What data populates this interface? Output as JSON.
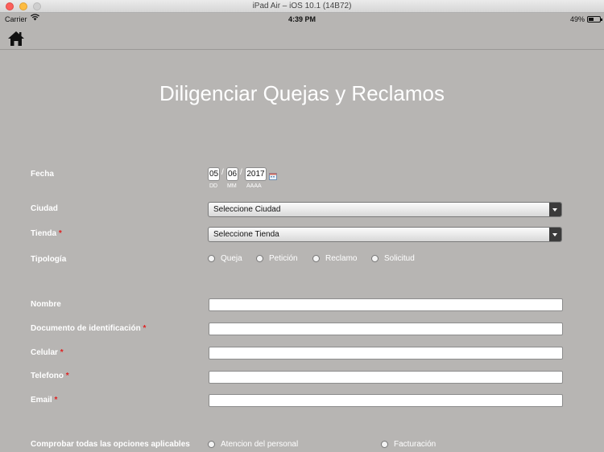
{
  "window": {
    "title": "iPad Air – iOS 10.1 (14B72)"
  },
  "status_bar": {
    "carrier": "Carrier",
    "time": "4:39 PM",
    "battery": "49%",
    "battery_level": 0.49
  },
  "nav": {
    "home_icon": "home-icon"
  },
  "page": {
    "title": "Diligenciar Quejas y Reclamos"
  },
  "form": {
    "fecha": {
      "label": "Fecha",
      "day": "05",
      "month": "06",
      "year": "2017",
      "sep": "/",
      "hint_day": "DD",
      "hint_month": "MM",
      "hint_year": "AAAA"
    },
    "ciudad": {
      "label": "Ciudad",
      "value": "Seleccione Ciudad"
    },
    "tienda": {
      "label": "Tienda",
      "required": "*",
      "value": "Seleccione Tienda"
    },
    "tipologia": {
      "label": "Tipología",
      "options": [
        "Queja",
        "Petición",
        "Reclamo",
        "Solicitud"
      ]
    },
    "nombre": {
      "label": "Nombre",
      "value": ""
    },
    "documento": {
      "label": "Documento de identificación",
      "required": "*",
      "value": ""
    },
    "celular": {
      "label": "Celular",
      "required": "*",
      "value": ""
    },
    "telefono": {
      "label": "Telefono",
      "required": "*",
      "value": ""
    },
    "email": {
      "label": "Email",
      "required": "*",
      "value": ""
    },
    "comprobar": {
      "label": "Comprobar todas las opciones aplicables",
      "options": [
        "Atencion del personal",
        "Facturación"
      ]
    }
  }
}
